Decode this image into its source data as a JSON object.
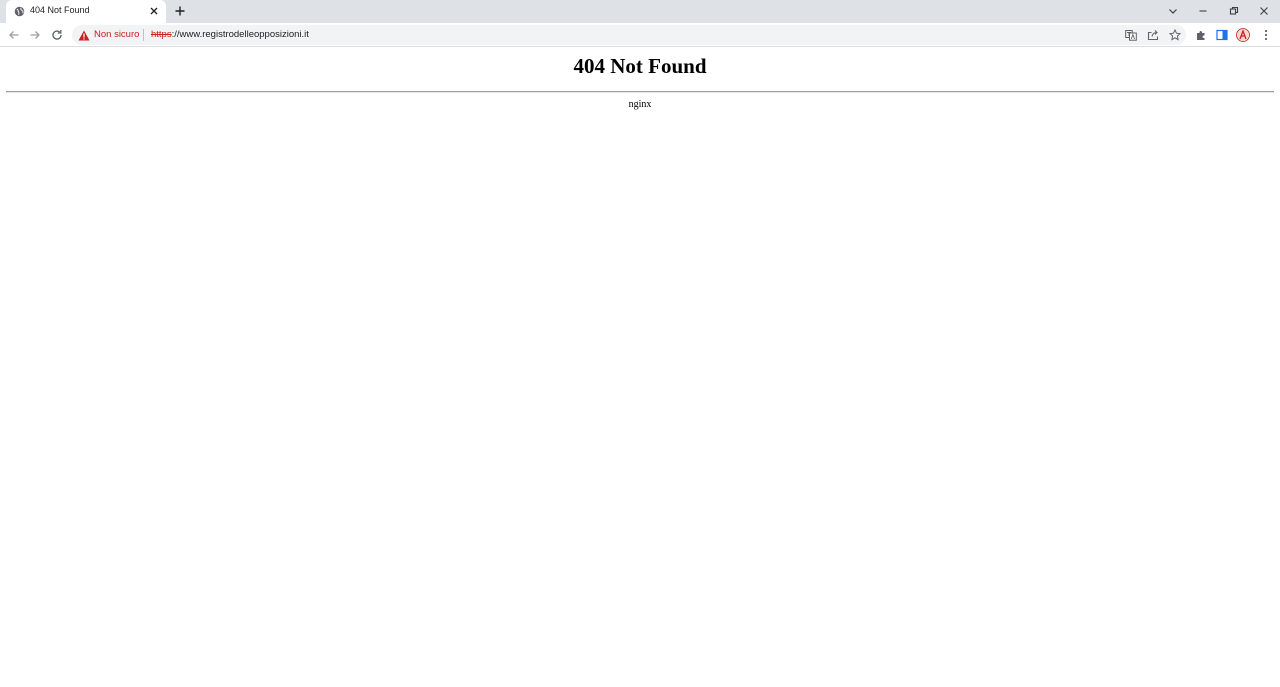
{
  "browser": {
    "tab": {
      "title": "404 Not Found",
      "favicon": "globe-icon"
    },
    "new_tab_label": "+",
    "window_controls": [
      "tab-search-icon",
      "minimize-icon",
      "restore-icon",
      "close-icon"
    ],
    "omnibox": {
      "security_label": "Non sicuro",
      "url_scheme": "https",
      "url_rest": "://www.registrodelleopposizioni.it",
      "warning_color": "#c5221f"
    },
    "toolbar_icons": [
      "translate-icon",
      "share-icon",
      "star-icon",
      "extensions-icon",
      "side-panel-icon",
      "profile-icon",
      "menu-icon"
    ]
  },
  "page": {
    "heading": "404 Not Found",
    "server": "nginx"
  },
  "colors": {
    "tabstrip": "#dee1e6",
    "omnibox": "#f1f3f4",
    "warning": "#c5221f",
    "text": "#000000"
  }
}
